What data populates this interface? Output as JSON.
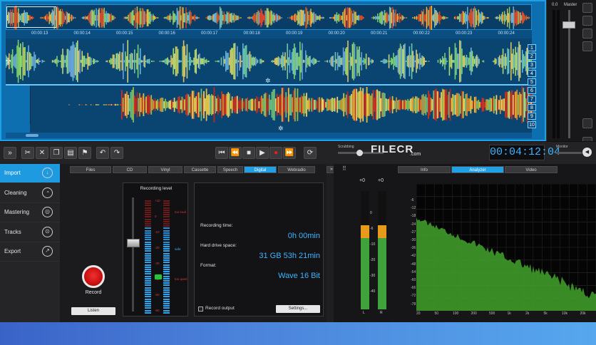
{
  "timeline": {
    "ticks": [
      "00:00:13",
      "00:00:14",
      "00:00:15",
      "00:00:16",
      "00:00:17",
      "00:00:18",
      "00:00:19",
      "00:00:20",
      "00:00:21",
      "00:00:22",
      "00:00:23",
      "00:00:24"
    ],
    "right_numbers": [
      "1",
      "2",
      "3",
      "4",
      "5",
      "6",
      "7",
      "8",
      "9",
      "10"
    ]
  },
  "master": {
    "level_label": "0.0",
    "title": "Master"
  },
  "transport": {
    "time": "00:04:12:04",
    "scrubbing_label": "Scrubbing",
    "monitor_label": "Monitor"
  },
  "watermark": {
    "text": "FILECR",
    ".com": ".com",
    "suffix": ".com"
  },
  "nav": [
    {
      "label": "Import"
    },
    {
      "label": "Cleaning"
    },
    {
      "label": "Mastering"
    },
    {
      "label": "Tracks"
    },
    {
      "label": "Export"
    }
  ],
  "source_tabs": [
    "Files",
    "CD",
    "Vinyl",
    "Cassette",
    "Speech",
    "Digital",
    "Webradio"
  ],
  "active_source_tab": "Digital",
  "record": {
    "label": "Record",
    "listen": "Listen"
  },
  "level": {
    "title": "Recording level",
    "scale": [
      "+10",
      "0",
      "-10",
      "-20",
      "-30",
      "-40",
      "-50",
      "-60"
    ],
    "zones": [
      "too loud",
      "safe",
      "too quiet"
    ]
  },
  "info": {
    "recording_time_label": "Recording time:",
    "recording_time_value": "0h 00min",
    "drive_label": "Hard drive space:",
    "drive_value": "31 GB  53h 21min",
    "format_label": "Format:",
    "format_value": "Wave  16 Bit",
    "record_output": "Record output",
    "settings": "Settings..."
  },
  "analyzer": {
    "tabs": [
      "Info",
      "Analyzer",
      "Video"
    ],
    "active_tab": "Analyzer",
    "peak_left": "+0",
    "peak_right": "+0",
    "meter_scale": [
      "0",
      "-6",
      "-10",
      "-20",
      "-30",
      "-40"
    ],
    "meter_channels": [
      "L",
      "R"
    ],
    "y_ticks": [
      "-6",
      "-12",
      "-18",
      "-24",
      "-27",
      "-30",
      "-36",
      "-42",
      "-48",
      "-54",
      "-60",
      "-66",
      "-72",
      "-78"
    ],
    "x_ticks": [
      "20",
      "50",
      "100",
      "200",
      "500",
      "1k",
      "2k",
      "5k",
      "10k",
      "20k"
    ]
  },
  "colors": {
    "accent": "#1e9be0",
    "wave_bg": "#0d6fb0",
    "time": "#3fb3ff",
    "record": "#d01818"
  }
}
